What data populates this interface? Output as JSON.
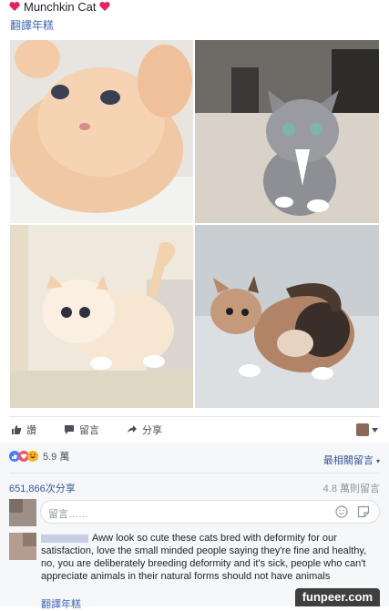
{
  "post": {
    "title": "Munchkin Cat",
    "translate_label": "翻譯年糕"
  },
  "photos": [
    {
      "alt": "orange kitten"
    },
    {
      "alt": "grey kitten"
    },
    {
      "alt": "white munchkin cat"
    },
    {
      "alt": "calico munchkin kitten"
    }
  ],
  "actions": {
    "like": "讚",
    "comment": "留言",
    "share": "分享"
  },
  "reactions": {
    "count": "5.9 萬",
    "sort": "最相關留言"
  },
  "stats": {
    "shares": "651,866次分享",
    "replies": "4.8 萬則留言"
  },
  "comment_box": {
    "placeholder": "留言……"
  },
  "comment": {
    "text": "Aww look so cute these cats bred with deformity for our satisfaction, love the small minded people saying they're fine and healthy, no, you are deliberately breeding deformity and it's sick, people who can't appreciate animals in their natural forms should not have animals",
    "translate_label": "翻譯年糕"
  },
  "watermark": "funpeer.com",
  "colors": {
    "link": "#4267b2",
    "heart": "#e0245e",
    "like_blue": "#4080ff"
  }
}
